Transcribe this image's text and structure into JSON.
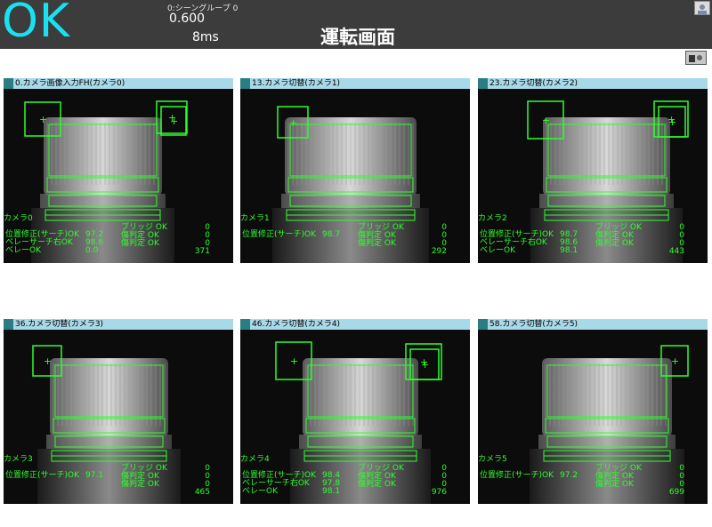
{
  "header": {
    "status": "OK",
    "scene_group": "0:シーングループ 0",
    "score": "0.600",
    "time": "8ms",
    "title": "運転画面"
  },
  "colors": {
    "ok": "#18e2f2",
    "overlay": "#2cff2c",
    "panel_header": "#a7d9e8"
  },
  "panels": [
    {
      "title": "0.カメラ画像入力FH(カメラ0)",
      "camera": "カメラ0",
      "l1": "位置修正(サーチ)OK",
      "v1": "97.2",
      "r1": "ブリッジ OK",
      "n1": "0",
      "l2": "ベレーサーチ右OK",
      "v2": "98.6",
      "r2": "傷判定 OK",
      "n2": "0",
      "l3": "ベレーOK",
      "v3": "0.0",
      "r3": "傷判定 OK",
      "n3": "0",
      "n4": "371"
    },
    {
      "title": "13.カメラ切替(カメラ1)",
      "camera": "カメラ1",
      "l1": "位置修正(サーチ)OK",
      "v1": "98.7",
      "r1": "ブリッジ OK",
      "n1": "0",
      "l2": "",
      "v2": "",
      "r2": "傷判定 OK",
      "n2": "0",
      "l3": "",
      "v3": "",
      "r3": "傷判定 OK",
      "n3": "0",
      "n4": "292"
    },
    {
      "title": "23.カメラ切替(カメラ2)",
      "camera": "カメラ2",
      "l1": "位置修正(サーチ)OK",
      "v1": "98.7",
      "r1": "ブリッジ OK",
      "n1": "0",
      "l2": "ベレーサーチ右OK",
      "v2": "98.6",
      "r2": "傷判定 OK",
      "n2": "0",
      "l3": "ベレーOK",
      "v3": "98.1",
      "r3": "傷判定 OK",
      "n3": "0",
      "n4": "443"
    },
    {
      "title": "36.カメラ切替(カメラ3)",
      "camera": "カメラ3",
      "l1": "位置修正(サーチ)OK",
      "v1": "97.1",
      "r1": "ブリッジ OK",
      "n1": "0",
      "l2": "",
      "v2": "",
      "r2": "傷判定 OK",
      "n2": "0",
      "l3": "",
      "v3": "",
      "r3": "傷判定 OK",
      "n3": "0",
      "n4": "465"
    },
    {
      "title": "46.カメラ切替(カメラ4)",
      "camera": "カメラ4",
      "l1": "位置修正(サーチ)OK",
      "v1": "98.4",
      "r1": "ブリッジ OK",
      "n1": "0",
      "l2": "ベレーサーチ右OK",
      "v2": "97.8",
      "r2": "傷判定 OK",
      "n2": "0",
      "l3": "ベレーOK",
      "v3": "98.1",
      "r3": "傷判定 OK",
      "n3": "0",
      "n4": "976"
    },
    {
      "title": "58.カメラ切替(カメラ5)",
      "camera": "カメラ5",
      "l1": "位置修正(サーチ)OK",
      "v1": "97.2",
      "r1": "ブリッジ OK",
      "n1": "0",
      "l2": "",
      "v2": "",
      "r2": "傷判定 OK",
      "n2": "0",
      "l3": "",
      "v3": "",
      "r3": "傷判定 OK",
      "n3": "0",
      "n4": "699"
    }
  ]
}
